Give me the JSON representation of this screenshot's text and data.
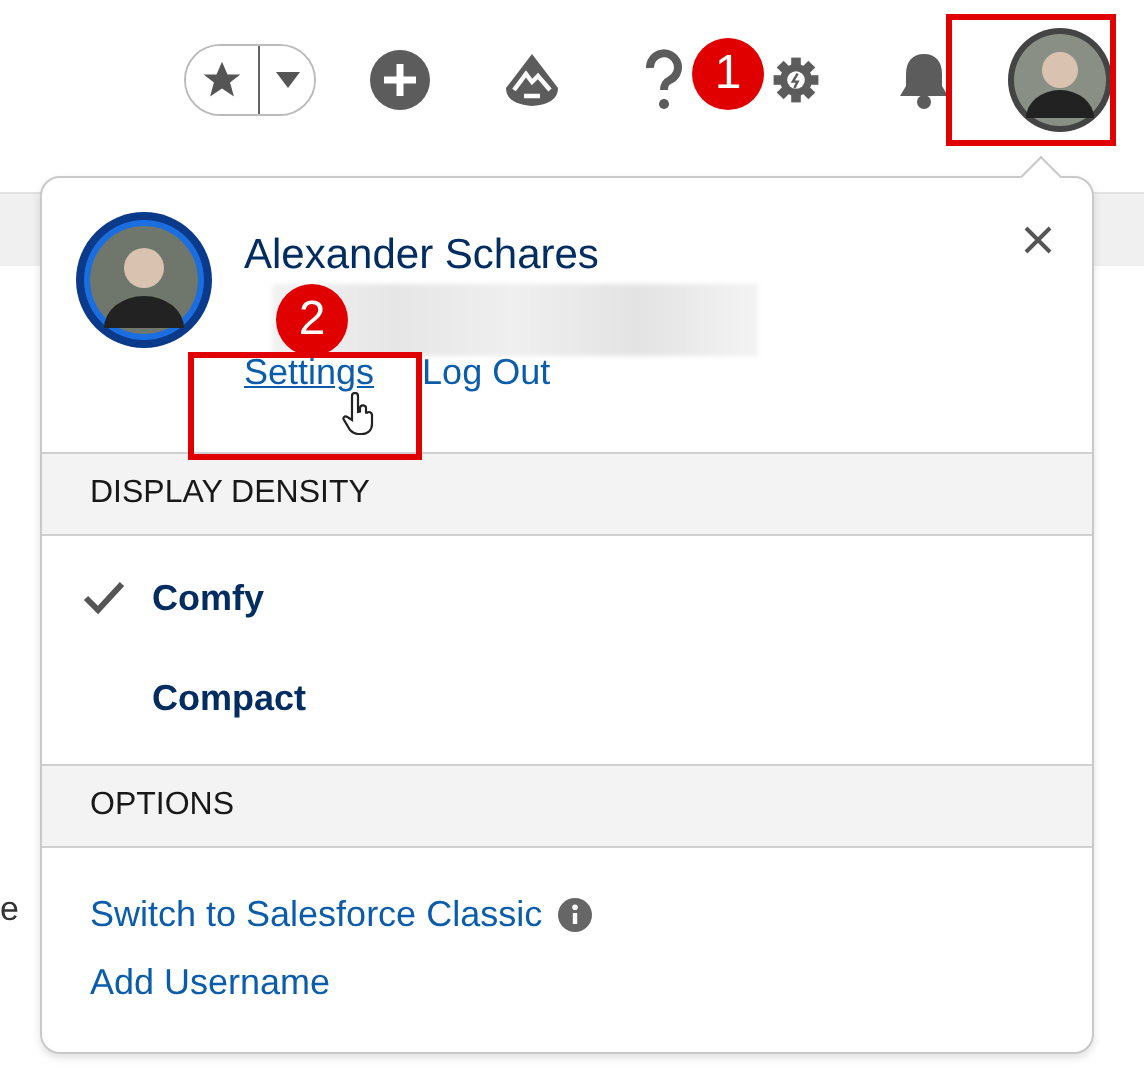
{
  "header": {
    "icons": [
      {
        "kind": "favorites"
      },
      {
        "kind": "add"
      },
      {
        "kind": "trailhead"
      },
      {
        "kind": "help"
      },
      {
        "kind": "setup"
      },
      {
        "kind": "notifications"
      },
      {
        "kind": "avatar"
      }
    ]
  },
  "background": {
    "text_fragment": "e"
  },
  "callouts": [
    {
      "number": "1"
    },
    {
      "number": "2"
    }
  ],
  "profile_menu": {
    "user_name": "Alexander Schares",
    "links": [
      {
        "label": "Settings",
        "hovered": true
      },
      {
        "label": "Log Out",
        "hovered": false
      }
    ],
    "sections": [
      {
        "title": "DISPLAY DENSITY",
        "items": [
          {
            "kind": "option",
            "label": "Comfy",
            "selected": true
          },
          {
            "kind": "option",
            "label": "Compact",
            "selected": false
          }
        ]
      },
      {
        "title": "OPTIONS",
        "items": [
          {
            "kind": "link",
            "label": "Switch to Salesforce Classic",
            "info": true
          },
          {
            "kind": "link",
            "label": "Add Username",
            "info": false
          }
        ]
      }
    ]
  }
}
